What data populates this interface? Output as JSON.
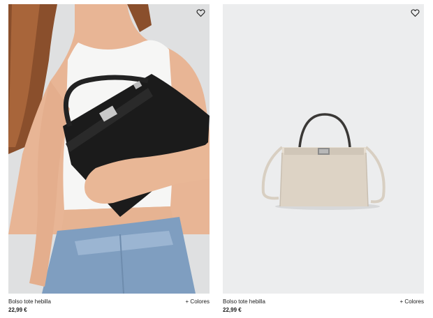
{
  "products": [
    {
      "name": "Bolso tote hebilla",
      "price": "22,99 €",
      "colors_label": "+ Colores",
      "favorite_icon": "heart-outline-icon",
      "image": "model-carrying-black-tote-bag",
      "bag_color": "#1b1b1b"
    },
    {
      "name": "Bolso tote hebilla",
      "price": "22,99 €",
      "colors_label": "+ Colores",
      "favorite_icon": "heart-outline-icon",
      "image": "beige-tote-bag-product-shot",
      "bag_color": "#ddd3c5"
    }
  ]
}
